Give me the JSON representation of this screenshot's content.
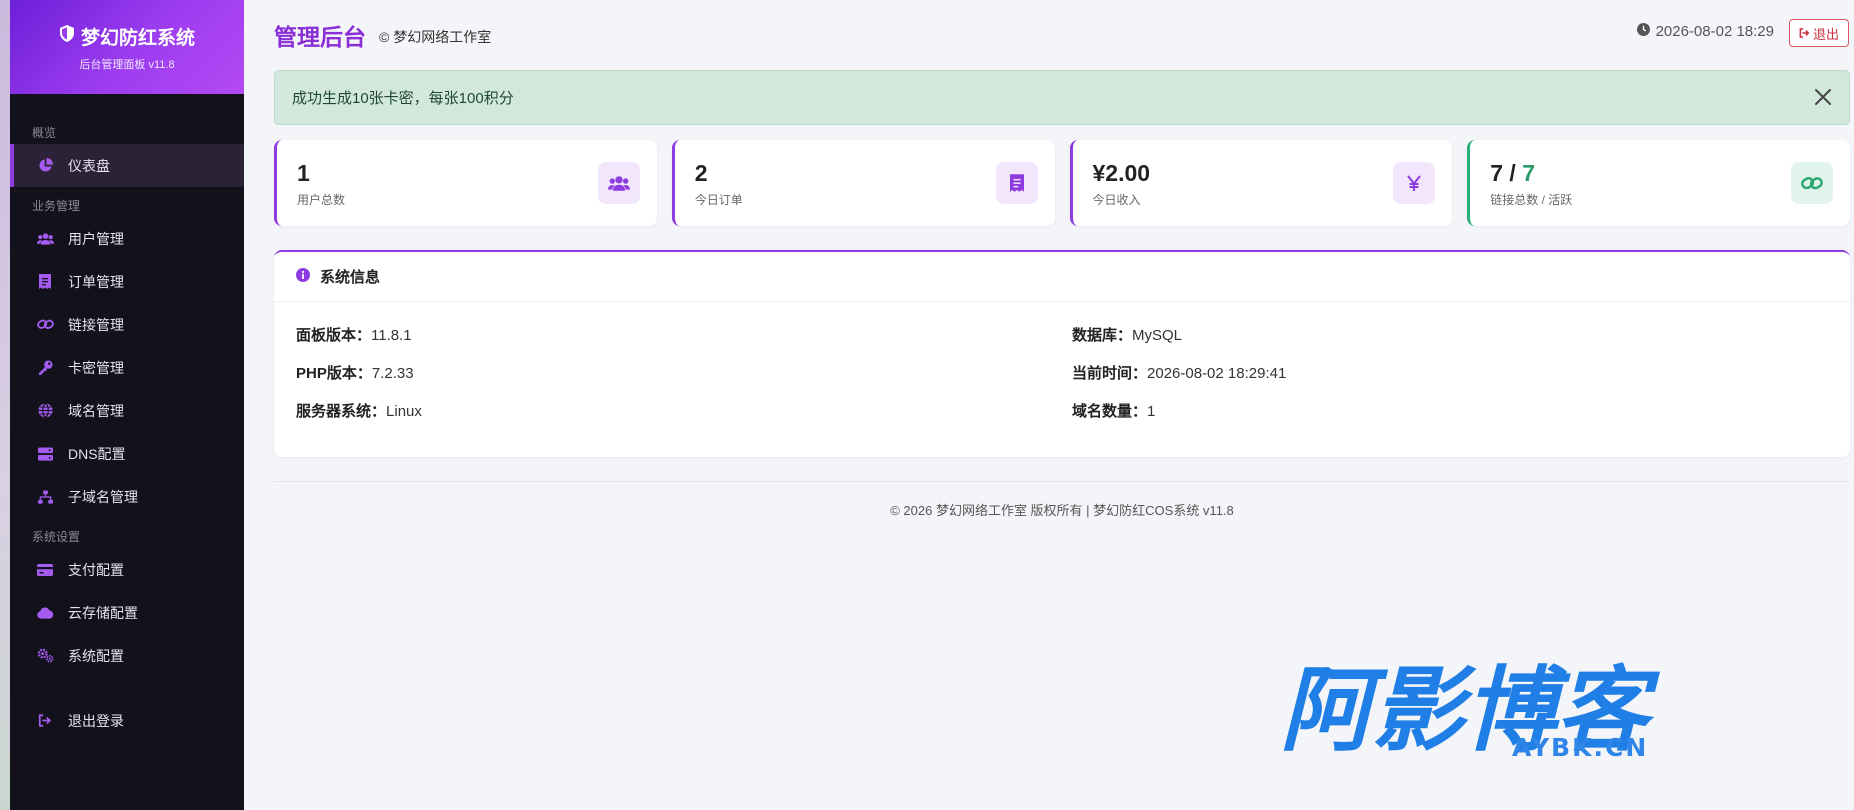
{
  "brand": {
    "title": "梦幻防红系统",
    "subtitle": "后台管理面板 v11.8"
  },
  "sidebar": {
    "sections": {
      "overview": "概览",
      "business": "业务管理",
      "system": "系统设置"
    },
    "items": {
      "dashboard": {
        "label": "仪表盘",
        "icon": "chart-pie-icon"
      },
      "users": {
        "label": "用户管理",
        "icon": "users-icon"
      },
      "orders": {
        "label": "订单管理",
        "icon": "receipt-icon"
      },
      "links": {
        "label": "链接管理",
        "icon": "link-icon"
      },
      "cards": {
        "label": "卡密管理",
        "icon": "key-icon"
      },
      "domains": {
        "label": "域名管理",
        "icon": "globe-icon"
      },
      "dns": {
        "label": "DNS配置",
        "icon": "server-icon"
      },
      "subdomains": {
        "label": "子域名管理",
        "icon": "sitemap-icon"
      },
      "payment": {
        "label": "支付配置",
        "icon": "credit-card-icon"
      },
      "storage": {
        "label": "云存储配置",
        "icon": "cloud-icon"
      },
      "settings": {
        "label": "系统配置",
        "icon": "gears-icon"
      },
      "logout": {
        "label": "退出登录",
        "icon": "sign-out-icon"
      }
    }
  },
  "header": {
    "title": "管理后台",
    "subtitle": "© 梦幻网络工作室",
    "datetime": "2026-08-02 18:29",
    "logout_label": "退出"
  },
  "alert": {
    "message": "成功生成10张卡密，每张100积分"
  },
  "stats": {
    "users": {
      "value": "1",
      "label": "用户总数"
    },
    "orders": {
      "value": "2",
      "label": "今日订单"
    },
    "income": {
      "value": "¥2.00",
      "label": "今日收入"
    },
    "links": {
      "total": "7",
      "separator": " / ",
      "active": "7",
      "label": "链接总数 / 活跃"
    }
  },
  "system_info": {
    "title": "系统信息",
    "panel_version": {
      "label": "面板版本：",
      "value": "11.8.1"
    },
    "php_version": {
      "label": "PHP版本：",
      "value": "7.2.33"
    },
    "server_os": {
      "label": "服务器系统：",
      "value": "Linux"
    },
    "database": {
      "label": "数据库：",
      "value": "MySQL"
    },
    "current_time": {
      "label": "当前时间：",
      "value": "2026-08-02 18:29:41"
    },
    "domain_count": {
      "label": "域名数量：",
      "value": "1"
    }
  },
  "footer": {
    "text": "© 2026 梦幻网络工作室 版权所有 | 梦幻防红COS系统 v11.8"
  },
  "watermark": {
    "main": "阿影博客",
    "sub": "AYBK.CN"
  },
  "colors": {
    "accent": "#8e3be0",
    "sidebar_bg": "#13111b",
    "success_bg": "#d3e8dc",
    "green": "#2aa86f",
    "danger": "#c8323f"
  }
}
